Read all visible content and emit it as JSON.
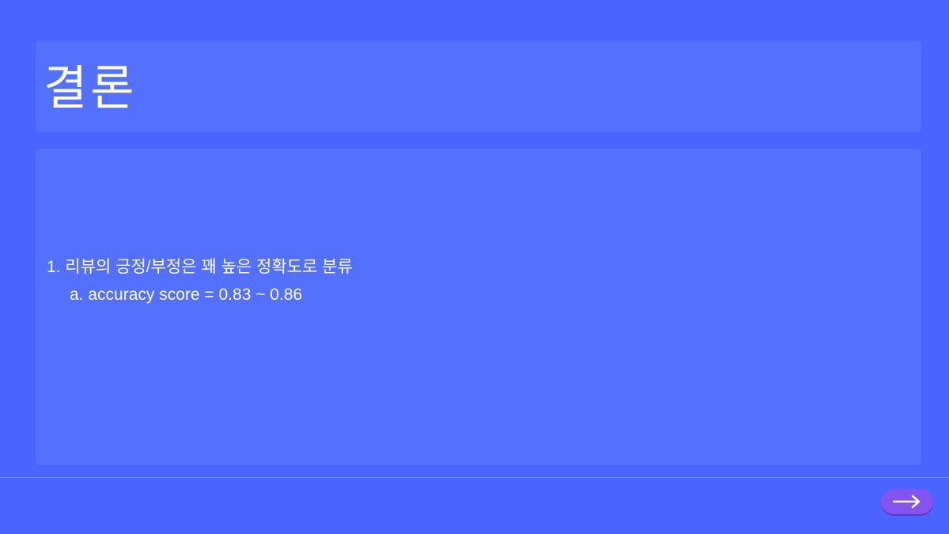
{
  "slide": {
    "title": "결론",
    "items": [
      "1. 리뷰의 긍정/부정은 꽤 높은 정확도로 분류",
      "a. accuracy score = 0.83 ~ 0.86"
    ]
  },
  "nav": {
    "next_icon": "arrow-right-icon"
  }
}
